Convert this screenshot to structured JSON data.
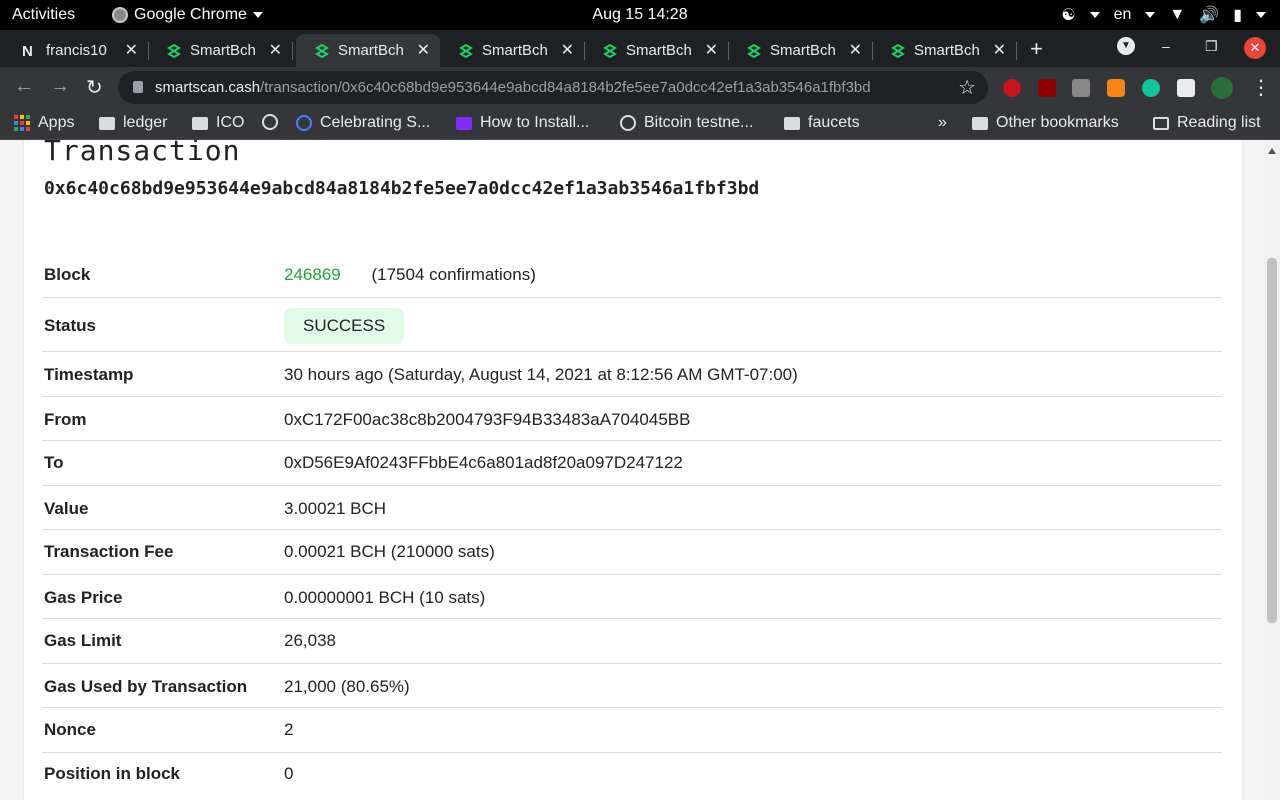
{
  "system": {
    "activities": "Activities",
    "app_name": "Google Chrome",
    "clock": "Aug 15  14:28",
    "lang": "en"
  },
  "tabs": [
    {
      "title": "francis10"
    },
    {
      "title": "SmartBch"
    },
    {
      "title": "SmartBch"
    },
    {
      "title": "SmartBch"
    },
    {
      "title": "SmartBch"
    },
    {
      "title": "SmartBch"
    },
    {
      "title": "SmartBch"
    }
  ],
  "toolbar": {
    "url_host": "smartscan.cash",
    "url_path": "/transaction/0x6c40c68bd9e953644e9abcd84a8184b2fe5ee7a0dcc42ef1a3ab3546a1fbf3bd"
  },
  "bookmarks": {
    "items": [
      "Apps",
      "ledger",
      "ICO",
      "Celebrating S...",
      "How to Install...",
      "Bitcoin testne...",
      "faucets"
    ],
    "more": "»",
    "other": "Other bookmarks",
    "reading_list": "Reading list"
  },
  "transaction": {
    "title": "Transaction",
    "hash": "0x6c40c68bd9e953644e9abcd84a8184b2fe5ee7a0dcc42ef1a3ab3546a1fbf3bd",
    "labels": {
      "block": "Block",
      "status": "Status",
      "timestamp": "Timestamp",
      "from": "From",
      "to": "To",
      "value": "Value",
      "fee": "Transaction Fee",
      "gas_price": "Gas Price",
      "gas_limit": "Gas Limit",
      "gas_used": "Gas Used by Transaction",
      "nonce": "Nonce",
      "position": "Position in block"
    },
    "block": "246869",
    "confirmations": "(17504 confirmations)",
    "status": "SUCCESS",
    "timestamp": "30 hours ago  (Saturday, August 14, 2021 at 8:12:56 AM GMT-07:00)",
    "from": "0xC172F00ac38c8b2004793F94B33483aA704045BB",
    "to": "0xD56E9Af0243FFbbE4c6a801ad8f20a097D247122",
    "value": "3.00021 BCH",
    "fee": "0.00021 BCH (210000 sats)",
    "gas_price": "0.00000001 BCH (10 sats)",
    "gas_limit": "26,038",
    "gas_used": "21,000 (80.65%)",
    "nonce": "2",
    "position": "0"
  },
  "colors": {
    "link": "#1aaa3a",
    "badge_bg": "#e0fce6",
    "chrome_dark": "#202124",
    "chrome_mid": "#35363a"
  }
}
